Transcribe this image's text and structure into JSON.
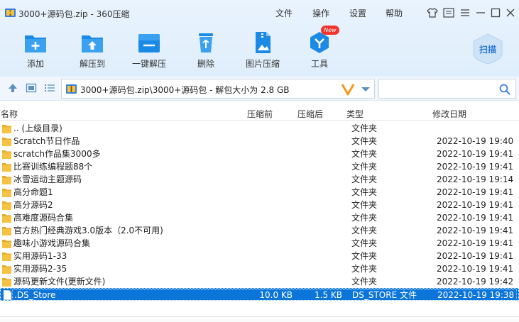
{
  "window": {
    "title": "3000+源码包.zip - 360压缩",
    "menus": [
      "文件",
      "操作",
      "设置",
      "帮助"
    ]
  },
  "toolbar": {
    "items": [
      {
        "label": "添加",
        "icon": "add-icon"
      },
      {
        "label": "解压到",
        "icon": "extract-to-icon"
      },
      {
        "label": "一键解压",
        "icon": "one-click-extract-icon"
      },
      {
        "label": "删除",
        "icon": "delete-icon"
      },
      {
        "label": "图片压缩",
        "icon": "image-compress-icon"
      },
      {
        "label": "工具",
        "icon": "tools-icon"
      }
    ],
    "new_badge": "New",
    "scan_label": "扫描"
  },
  "address": {
    "path": "3000+源码包.zip\\3000+源码包 - 解包大小为 2.8 GB",
    "search_placeholder": ""
  },
  "columns": {
    "name": "名称",
    "packed": "压缩前",
    "compressed": "压缩后",
    "type": "类型",
    "modified": "修改日期"
  },
  "files": [
    {
      "name": ".. (上级目录)",
      "packed": "",
      "compressed": "",
      "type": "文件夹",
      "modified": "",
      "kind": "folder"
    },
    {
      "name": "Scratch节日作品",
      "packed": "",
      "compressed": "",
      "type": "文件夹",
      "modified": "2022-10-19 19:40",
      "kind": "folder"
    },
    {
      "name": "scratch作品集3000多",
      "packed": "",
      "compressed": "",
      "type": "文件夹",
      "modified": "2022-10-19 19:41",
      "kind": "folder"
    },
    {
      "name": "比赛训练编程题88个",
      "packed": "",
      "compressed": "",
      "type": "文件夹",
      "modified": "2022-10-19 19:41",
      "kind": "folder"
    },
    {
      "name": "冰雪运动主题源码",
      "packed": "",
      "compressed": "",
      "type": "文件夹",
      "modified": "2022-10-19 19:14",
      "kind": "folder"
    },
    {
      "name": "高分命题1",
      "packed": "",
      "compressed": "",
      "type": "文件夹",
      "modified": "2022-10-19 19:41",
      "kind": "folder"
    },
    {
      "name": "高分源码2",
      "packed": "",
      "compressed": "",
      "type": "文件夹",
      "modified": "2022-10-19 19:41",
      "kind": "folder"
    },
    {
      "name": "高难度源码合集",
      "packed": "",
      "compressed": "",
      "type": "文件夹",
      "modified": "2022-10-19 19:41",
      "kind": "folder"
    },
    {
      "name": "官方热门经典游戏3.0版本（2.0不可用)",
      "packed": "",
      "compressed": "",
      "type": "文件夹",
      "modified": "2022-10-19 19:41",
      "kind": "folder"
    },
    {
      "name": "趣味小游戏源码合集",
      "packed": "",
      "compressed": "",
      "type": "文件夹",
      "modified": "2022-10-19 19:41",
      "kind": "folder"
    },
    {
      "name": "实用源码1-33",
      "packed": "",
      "compressed": "",
      "type": "文件夹",
      "modified": "2022-10-19 19:41",
      "kind": "folder"
    },
    {
      "name": "实用源码2-35",
      "packed": "",
      "compressed": "",
      "type": "文件夹",
      "modified": "2022-10-19 19:41",
      "kind": "folder"
    },
    {
      "name": "源码更新文件(更新文件)",
      "packed": "",
      "compressed": "",
      "type": "文件夹",
      "modified": "2022-10-19 19:42",
      "kind": "folder"
    },
    {
      "name": ".DS_Store",
      "packed": "10.0 KB",
      "compressed": "1.5 KB",
      "type": "DS_STORE 文件",
      "modified": "2022-10-19 19:38",
      "kind": "file",
      "selected": true
    }
  ],
  "colors": {
    "accent": "#1a8ae5",
    "selection": "#0c75d9",
    "folder": "#f5c243",
    "header_bg": "#e4f0fc"
  }
}
